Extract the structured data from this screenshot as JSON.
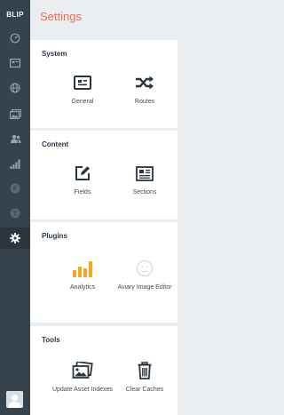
{
  "sidebar": {
    "brand": "BLIP",
    "items": [
      {
        "icon": "dashboard-icon"
      },
      {
        "icon": "entries-icon"
      },
      {
        "icon": "globe-icon"
      },
      {
        "icon": "assets-icon"
      },
      {
        "icon": "users-icon"
      },
      {
        "icon": "statistics-icon"
      },
      {
        "icon": "plugin-f-icon"
      },
      {
        "icon": "plugin-t-icon"
      },
      {
        "icon": "gear-icon",
        "active": true
      }
    ],
    "plugin_f_letter": "F",
    "plugin_t_letter": "T",
    "avatar": "user-avatar"
  },
  "page": {
    "title": "Settings"
  },
  "sections": [
    {
      "title": "System",
      "items": [
        {
          "label": "General",
          "icon": "general-icon"
        },
        {
          "label": "Routes",
          "icon": "shuffle-icon"
        }
      ]
    },
    {
      "title": "Content",
      "items": [
        {
          "label": "Fields",
          "icon": "pencil-square-icon"
        },
        {
          "label": "Sections",
          "icon": "newspaper-icon"
        }
      ]
    },
    {
      "title": "Plugins",
      "items": [
        {
          "label": "Analytics",
          "icon": "bar-chart-icon"
        },
        {
          "label": "Aviary Image Editor",
          "icon": "aviary-icon"
        }
      ]
    },
    {
      "title": "Tools",
      "items": [
        {
          "label": "Update Asset Indexes",
          "icon": "images-icon"
        },
        {
          "label": "Clear Caches",
          "icon": "trash-icon"
        }
      ]
    }
  ],
  "colors": {
    "accent": "#ef6c4d",
    "sidebar_bg": "#36424c",
    "analytics_orange": "#f5a623"
  }
}
